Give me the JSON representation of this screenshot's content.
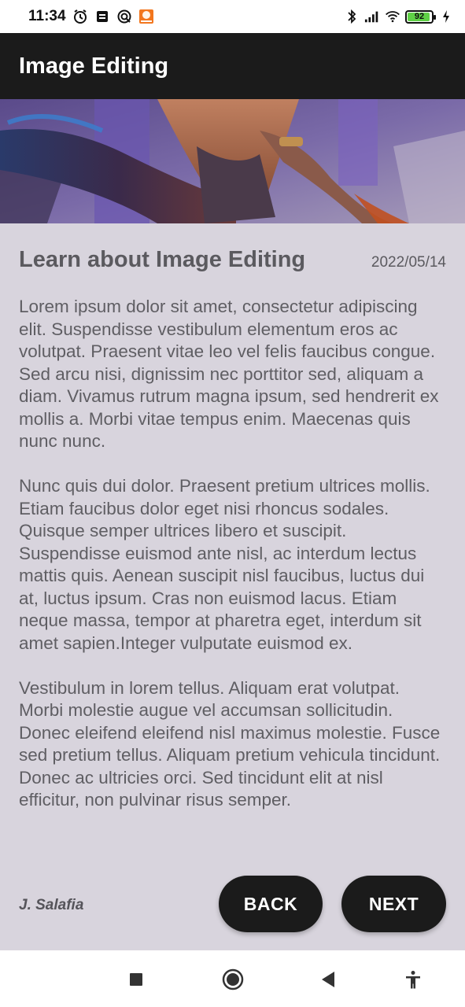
{
  "status_bar": {
    "time": "11:34",
    "battery_level": "92",
    "battery_fraction": 0.92,
    "icons": [
      "alarm-icon",
      "notification-icon",
      "sync-icon",
      "app-notification-icon",
      "bluetooth-icon",
      "signal-icon",
      "wifi-icon",
      "battery-icon",
      "charging-icon"
    ]
  },
  "app_bar": {
    "title": "Image Editing"
  },
  "hero": {
    "image": "hero-image"
  },
  "article": {
    "title": "Learn about Image Editing",
    "date": "2022/05/14",
    "paragraphs": [
      "Lorem ipsum dolor sit amet, consectetur adipiscing elit. Suspendisse vestibulum elementum eros ac volutpat. Praesent vitae leo vel felis faucibus congue. Sed arcu nisi, dignissim nec porttitor sed, aliquam a diam. Vivamus rutrum magna ipsum, sed hendrerit ex mollis a. Morbi vitae tempus enim. Maecenas quis nunc nunc.",
      "Nunc quis dui dolor. Praesent pretium ultrices mollis. Etiam faucibus dolor eget nisi rhoncus sodales. Quisque semper ultrices libero et suscipit. Suspendisse euismod ante nisl, ac interdum lectus mattis quis. Aenean suscipit nisl faucibus, luctus dui at, luctus ipsum. Cras non euismod lacus. Etiam neque massa, tempor at pharetra eget, interdum sit amet sapien.Integer vulputate euismod ex.",
      "Vestibulum in lorem tellus. Aliquam erat volutpat. Morbi molestie augue vel accumsan sollicitudin. Donec eleifend eleifend nisl maximus molestie. Fusce sed pretium tellus. Aliquam pretium vehicula tincidunt. Donec ac ultricies orci. Sed tincidunt elit at nisl efficitur, non pulvinar risus semper."
    ],
    "author": "J. Salafia"
  },
  "buttons": {
    "back": "BACK",
    "next": "NEXT"
  },
  "nav_bar": {
    "icons": [
      "recents-icon",
      "home-icon",
      "back-icon",
      "accessibility-icon"
    ]
  },
  "colors": {
    "app_bar": "#1b1b1b",
    "background": "#d8d4dd",
    "text": "#5f5e63",
    "button": "#1b1b1b",
    "battery": "#5fd146"
  }
}
